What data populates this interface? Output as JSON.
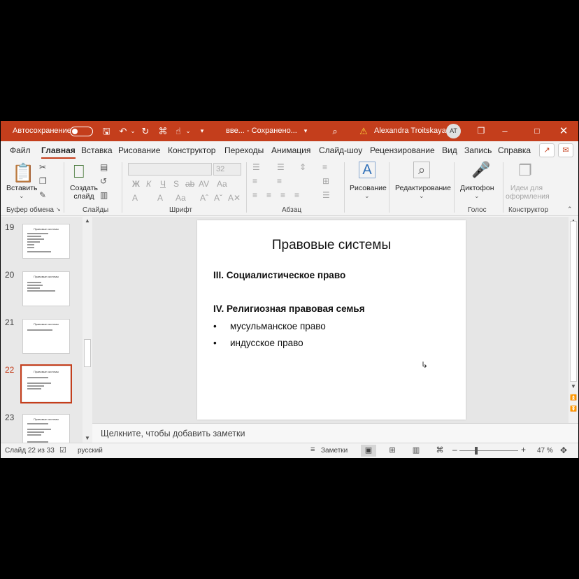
{
  "titlebar": {
    "autosave_label": "Автосохранение",
    "doc_title": "вве... - Сохранено...",
    "user_name": "Alexandra Troitskaya",
    "user_initials": "AT"
  },
  "tabs": [
    "Файл",
    "Главная",
    "Вставка",
    "Рисование",
    "Конструктор",
    "Переходы",
    "Анимация",
    "Слайд-шоу",
    "Рецензирование",
    "Вид",
    "Запись",
    "Справка"
  ],
  "ribbon": {
    "paste_label": "Вставить",
    "new_slide_label": "Создать слайд",
    "drawing_label": "Рисование",
    "editing_label": "Редактирование",
    "dictation_label": "Диктофон",
    "design_ideas_label": "Идеи для оформления",
    "font_size": "32",
    "groups": {
      "clipboard": "Буфер обмена",
      "slides": "Слайды",
      "font": "Шрифт",
      "paragraph": "Абзац",
      "voice": "Голос",
      "designer": "Конструктор"
    }
  },
  "thumbnails": [
    {
      "num": "19",
      "title": "Правовые системы"
    },
    {
      "num": "20",
      "title": "Правовые системы"
    },
    {
      "num": "21",
      "title": "Правовые системы"
    },
    {
      "num": "22",
      "title": "Правовые системы"
    },
    {
      "num": "23",
      "title": "Правовые системы"
    }
  ],
  "slide": {
    "title": "Правовые системы",
    "item3": "III.  Социалистическое право",
    "item4": "IV.   Религиозная правовая семья",
    "bullet1": "мусульманское право",
    "bullet2": "индусское право",
    "bullet_char": "•"
  },
  "notes_placeholder": "Щелкните, чтобы добавить заметки",
  "status": {
    "slide_counter": "Слайд 22 из 33",
    "language": "русский",
    "notes_button": "Заметки",
    "zoom": "47 %"
  }
}
